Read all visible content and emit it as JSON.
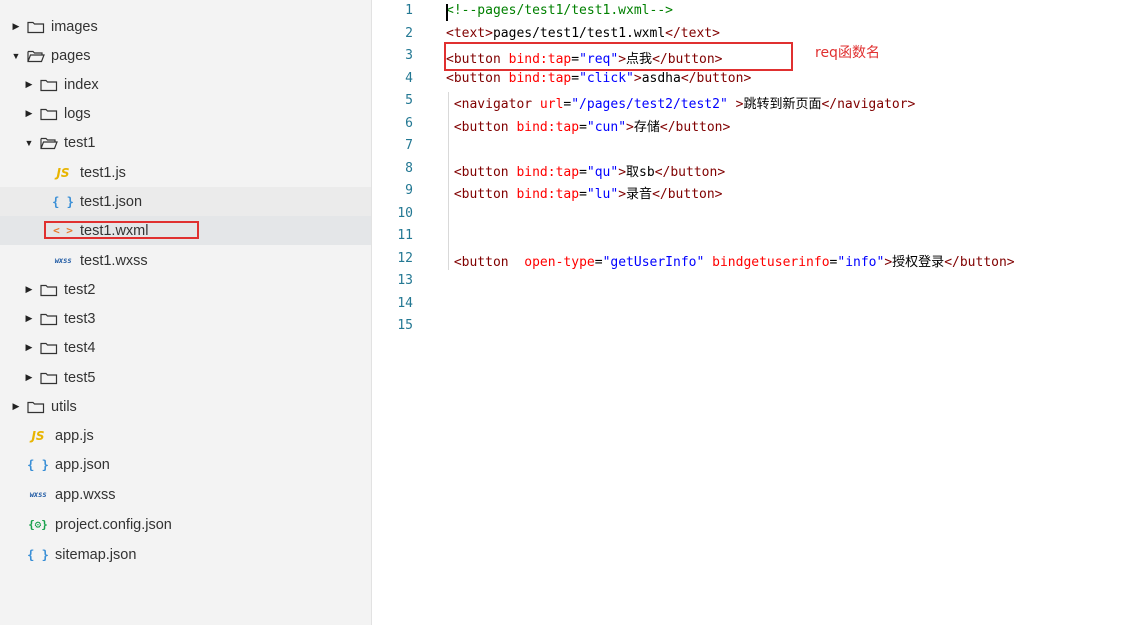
{
  "file_tree": {
    "items": [
      {
        "label": "images",
        "type": "folder",
        "expanded": false
      },
      {
        "label": "pages",
        "type": "folder",
        "expanded": true
      },
      {
        "label": "index",
        "type": "folder",
        "expanded": false
      },
      {
        "label": "logs",
        "type": "folder",
        "expanded": false
      },
      {
        "label": "test1",
        "type": "folder",
        "expanded": true
      },
      {
        "label": "test1.js",
        "type": "js",
        "icon_text": "JS"
      },
      {
        "label": "test1.json",
        "type": "json",
        "icon_text": "{ }"
      },
      {
        "label": "test1.wxml",
        "type": "wxml",
        "icon_text": "< >"
      },
      {
        "label": "test1.wxss",
        "type": "wxss",
        "icon_text": "wxss"
      },
      {
        "label": "test2",
        "type": "folder",
        "expanded": false
      },
      {
        "label": "test3",
        "type": "folder",
        "expanded": false
      },
      {
        "label": "test4",
        "type": "folder",
        "expanded": false
      },
      {
        "label": "test5",
        "type": "folder",
        "expanded": false
      },
      {
        "label": "utils",
        "type": "folder",
        "expanded": false
      },
      {
        "label": "app.js",
        "type": "js",
        "icon_text": "JS"
      },
      {
        "label": "app.json",
        "type": "json",
        "icon_text": "{ }"
      },
      {
        "label": "app.wxss",
        "type": "wxss",
        "icon_text": "wxss"
      },
      {
        "label": "project.config.json",
        "type": "config",
        "icon_text": "{⚙}"
      },
      {
        "label": "sitemap.json",
        "type": "json",
        "icon_text": "{ }"
      }
    ]
  },
  "editor": {
    "line_numbers": [
      "1",
      "2",
      "3",
      "4",
      "5",
      "6",
      "7",
      "8",
      "9",
      "10",
      "11",
      "12",
      "13",
      "14",
      "15"
    ],
    "lines": [
      {
        "tokens": [
          {
            "t": "<!--pages/test1/test1.wxml-->",
            "c": "comment"
          }
        ]
      },
      {
        "tokens": [
          {
            "t": "<text>",
            "c": "tag"
          },
          {
            "t": "pages/test1/test1.wxml",
            "c": "text"
          },
          {
            "t": "</text>",
            "c": "tag"
          }
        ]
      },
      {
        "tokens": [
          {
            "t": "<button ",
            "c": "tag"
          },
          {
            "t": "bind:tap",
            "c": "attr"
          },
          {
            "t": "=",
            "c": "text"
          },
          {
            "t": "\"req\"",
            "c": "val"
          },
          {
            "t": ">",
            "c": "tag"
          },
          {
            "t": "点我",
            "c": "text"
          },
          {
            "t": "</button>",
            "c": "tag"
          }
        ]
      },
      {
        "tokens": [
          {
            "t": "<button ",
            "c": "tag"
          },
          {
            "t": "bind:tap",
            "c": "attr"
          },
          {
            "t": "=",
            "c": "text"
          },
          {
            "t": "\"click\"",
            "c": "val"
          },
          {
            "t": ">",
            "c": "tag"
          },
          {
            "t": "asdha",
            "c": "text"
          },
          {
            "t": "</button>",
            "c": "tag"
          }
        ]
      },
      {
        "tokens": [
          {
            "t": " <navigator ",
            "c": "tag"
          },
          {
            "t": "url",
            "c": "attr"
          },
          {
            "t": "=",
            "c": "text"
          },
          {
            "t": "\"/pages/test2/test2\"",
            "c": "val"
          },
          {
            "t": " >",
            "c": "tag"
          },
          {
            "t": "跳转到新页面",
            "c": "text"
          },
          {
            "t": "</navigator>",
            "c": "tag"
          }
        ]
      },
      {
        "tokens": [
          {
            "t": " <button ",
            "c": "tag"
          },
          {
            "t": "bind:tap",
            "c": "attr"
          },
          {
            "t": "=",
            "c": "text"
          },
          {
            "t": "\"cun\"",
            "c": "val"
          },
          {
            "t": ">",
            "c": "tag"
          },
          {
            "t": "存储",
            "c": "text"
          },
          {
            "t": "</button>",
            "c": "tag"
          }
        ]
      },
      {
        "tokens": []
      },
      {
        "tokens": [
          {
            "t": " <button ",
            "c": "tag"
          },
          {
            "t": "bind:tap",
            "c": "attr"
          },
          {
            "t": "=",
            "c": "text"
          },
          {
            "t": "\"qu\"",
            "c": "val"
          },
          {
            "t": ">",
            "c": "tag"
          },
          {
            "t": "取sb",
            "c": "text"
          },
          {
            "t": "</button>",
            "c": "tag"
          }
        ]
      },
      {
        "tokens": [
          {
            "t": " <button ",
            "c": "tag"
          },
          {
            "t": "bind:tap",
            "c": "attr"
          },
          {
            "t": "=",
            "c": "text"
          },
          {
            "t": "\"lu\"",
            "c": "val"
          },
          {
            "t": ">",
            "c": "tag"
          },
          {
            "t": "录音",
            "c": "text"
          },
          {
            "t": "</button>",
            "c": "tag"
          }
        ]
      },
      {
        "tokens": []
      },
      {
        "tokens": []
      },
      {
        "tokens": [
          {
            "t": " <button  ",
            "c": "tag"
          },
          {
            "t": "open-type",
            "c": "attr"
          },
          {
            "t": "=",
            "c": "text"
          },
          {
            "t": "\"getUserInfo\"",
            "c": "val"
          },
          {
            "t": " ",
            "c": "text"
          },
          {
            "t": "bindgetuserinfo",
            "c": "attr"
          },
          {
            "t": "=",
            "c": "text"
          },
          {
            "t": "\"info\"",
            "c": "val"
          },
          {
            "t": ">",
            "c": "tag"
          },
          {
            "t": "授权登录",
            "c": "text"
          },
          {
            "t": "</button>",
            "c": "tag"
          }
        ]
      },
      {
        "tokens": []
      },
      {
        "tokens": []
      },
      {
        "tokens": []
      }
    ]
  },
  "annotation": {
    "text": "req函数名"
  },
  "colors": {
    "highlight_box": "#e03030",
    "line_number": "#237893",
    "comment": "#008000",
    "tag": "#800000",
    "attribute": "#ff0000",
    "value": "#0000ff"
  }
}
